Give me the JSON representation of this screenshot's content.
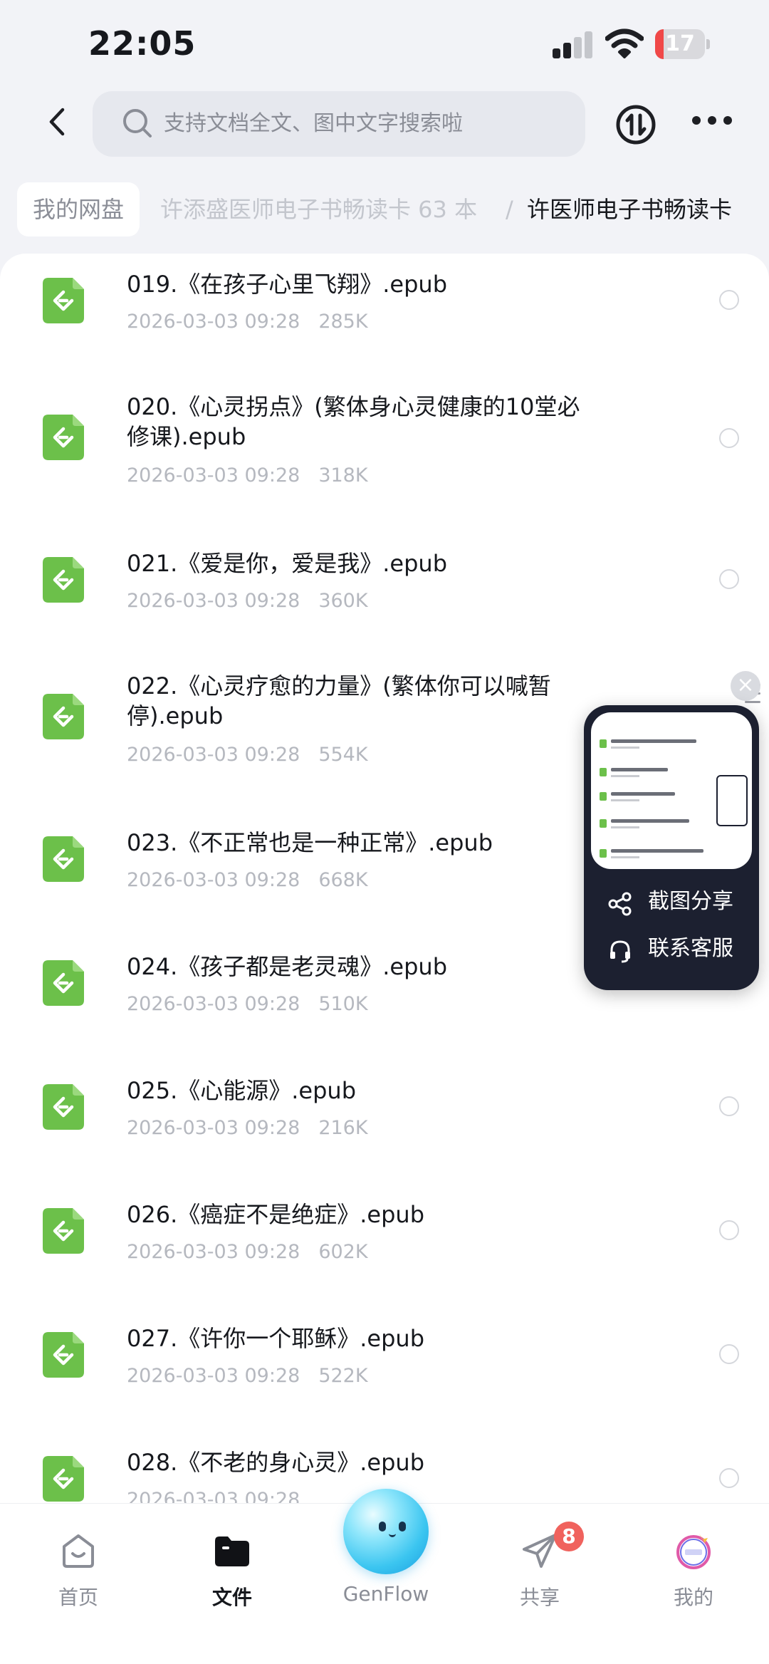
{
  "status_bar": {
    "time": "22:05",
    "battery": "17",
    "battery_level": 0.17,
    "battery_color": "#f04848"
  },
  "header": {
    "search_placeholder": "支持文档全文、图中文字搜索啦",
    "back_icon": "chevron-left-icon",
    "sort_icon": "sort-circle-icon",
    "more_icon": "more-dots-icon"
  },
  "breadcrumb": {
    "root": "我的网盘",
    "middle": "许添盛医师电子书畅读卡 63 本",
    "separator": "/",
    "current": "许医师电子书畅读卡"
  },
  "files": [
    {
      "name": "019.《在孩子心里飞翔》.epub",
      "date": "2026-03-03 09:28",
      "size": "285K"
    },
    {
      "name": "020.《心灵拐点》(繁体身心灵健康的10堂必修课).epub",
      "date": "2026-03-03 09:28",
      "size": "318K"
    },
    {
      "name": "021.《爱是你，爱是我》.epub",
      "date": "2026-03-03 09:28",
      "size": "360K"
    },
    {
      "name": "022.《心灵疗愈的力量》(繁体你可以喊暂停).epub",
      "date": "2026-03-03 09:28",
      "size": "554K"
    },
    {
      "name": "023.《不正常也是一种正常》.epub",
      "date": "2026-03-03 09:28",
      "size": "668K"
    },
    {
      "name": "024.《孩子都是老灵魂》.epub",
      "date": "2026-03-03 09:28",
      "size": "510K"
    },
    {
      "name": "025.《心能源》.epub",
      "date": "2026-03-03 09:28",
      "size": "216K"
    },
    {
      "name": "026.《癌症不是绝症》.epub",
      "date": "2026-03-03 09:28",
      "size": "602K"
    },
    {
      "name": "027.《许你一个耶稣》.epub",
      "date": "2026-03-03 09:28",
      "size": "522K"
    },
    {
      "name": "028.《不老的身心灵》.epub",
      "date": "2026-03-03 09:28",
      "size": ""
    }
  ],
  "float_widget": {
    "share_label": "截图分享",
    "service_label": "联系客服",
    "close_glyph": "×"
  },
  "tabs": [
    {
      "label": "首页",
      "icon": "home-icon"
    },
    {
      "label": "文件",
      "icon": "folder-icon",
      "active": true
    },
    {
      "label": "GenFlow",
      "icon": "genflow-orb-icon"
    },
    {
      "label": "共享",
      "icon": "paper-plane-icon",
      "badge": "8"
    },
    {
      "label": "我的",
      "icon": "avatar-icon"
    }
  ],
  "colors": {
    "accent_green": "#6cc04a",
    "badge_red": "#f0625d",
    "widget_dark": "#1c2030"
  }
}
